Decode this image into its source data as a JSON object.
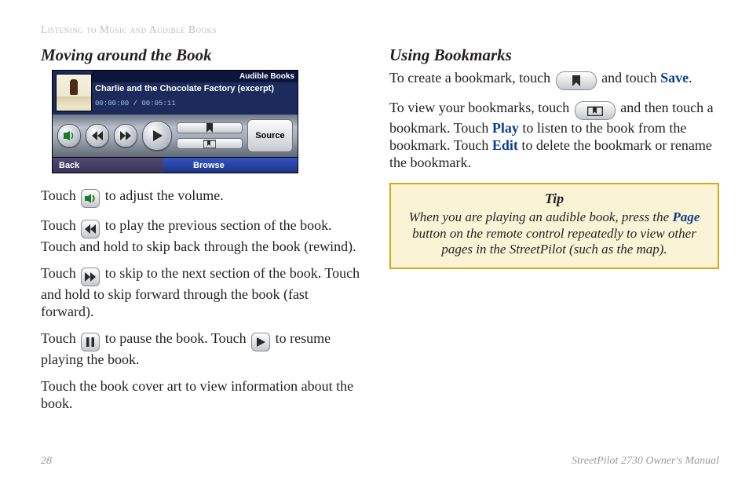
{
  "running_head": "Listening to Music and Audible Books",
  "left": {
    "heading": "Moving around the Book",
    "volume": {
      "pre": "Touch ",
      "post": " to adjust the volume."
    },
    "prev": {
      "pre": "Touch ",
      "post": " to play the previous section of the book. Touch and hold to skip back through the book (rewind)."
    },
    "next": {
      "pre": "Touch ",
      "post": " to skip to the next section of the book. Touch and hold to skip forward through the book (fast forward)."
    },
    "pause": {
      "pre": "Touch ",
      "mid": " to pause the book. Touch ",
      "post": " to resume playing the book."
    },
    "art": "Touch the book cover art to view information about the book."
  },
  "right": {
    "heading": "Using Bookmarks",
    "create": {
      "pre": "To create a bookmark, touch ",
      "mid": " and touch ",
      "kw": "Save",
      "post": "."
    },
    "view": {
      "pre": "To view your bookmarks, touch ",
      "mid": " and then touch a bookmark. Touch ",
      "kw1": "Play",
      "mid2": " to listen to the book from the bookmark. Touch ",
      "kw2": "Edit",
      "post": " to delete the bookmark or rename the bookmark."
    },
    "tip": {
      "title": "Tip",
      "pre": "When you are playing an audible book, press the ",
      "kw": "Page",
      "post": " button on the remote control repeatedly to view other pages in the StreetPilot (such as the map)."
    }
  },
  "device": {
    "header_bar": "Audible Books",
    "title": "Charlie and the Chocolate Factory (excerpt)",
    "time": "00:00:00 / 00:05:11",
    "source": "Source",
    "back": "Back",
    "browse": "Browse"
  },
  "footer": {
    "page": "28",
    "manual": "StreetPilot 2730 Owner's Manual"
  }
}
